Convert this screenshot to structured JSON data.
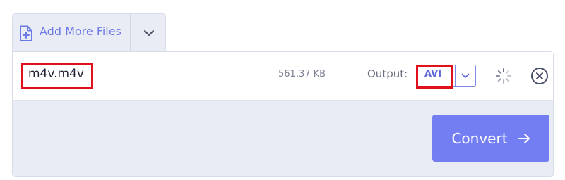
{
  "toolbar": {
    "add_more_files_label": "Add More Files",
    "add_icon": "file-plus-icon",
    "dropdown_icon": "chevron-down-icon"
  },
  "file": {
    "name": "m4v.m4v",
    "size": "561.37 KB",
    "output_label": "Output:",
    "output_format": "AVI",
    "status_icon": "loading-spinner-icon",
    "remove_icon": "close-circle-icon"
  },
  "actions": {
    "convert_label": "Convert",
    "convert_icon": "arrow-right-icon"
  },
  "colors": {
    "accent": "#747ef3",
    "highlight": "#e0101c",
    "panel_bg": "#e9ecf4"
  }
}
